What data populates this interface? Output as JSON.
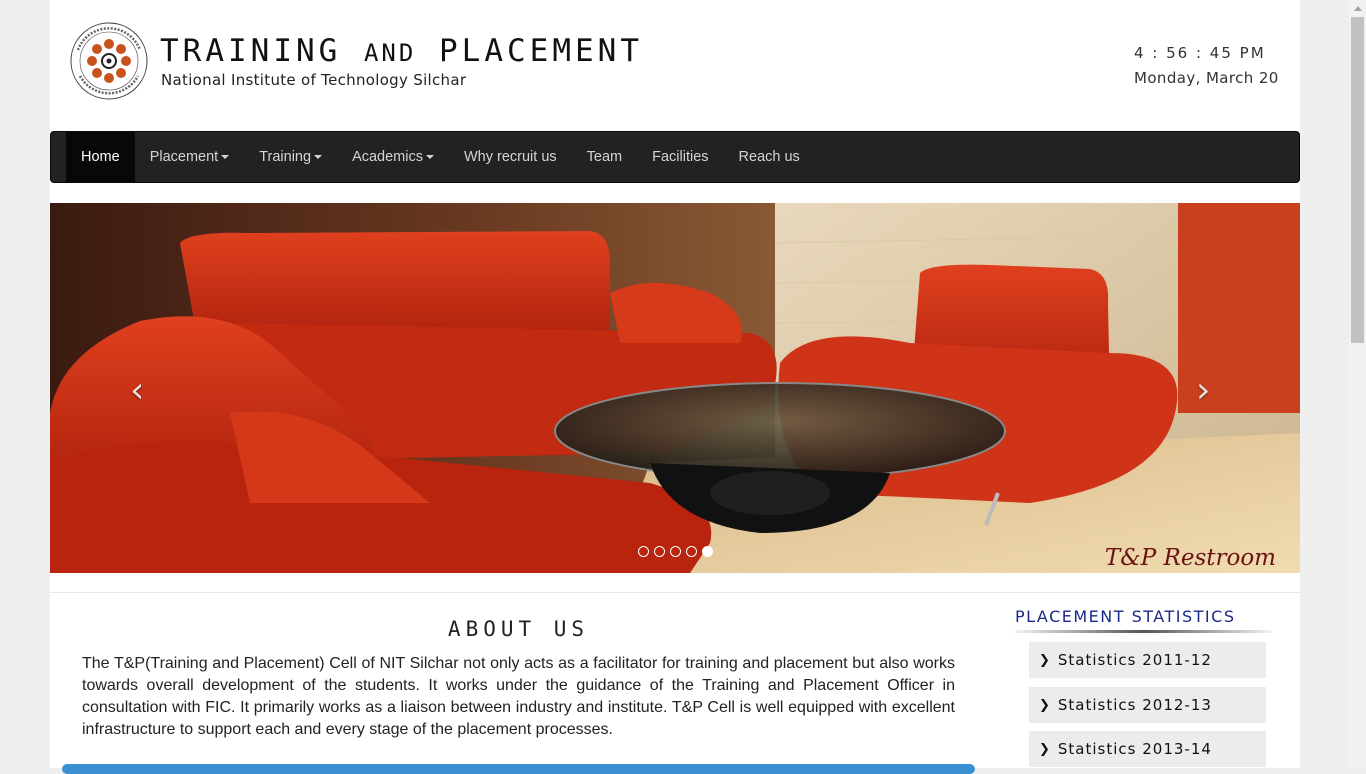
{
  "header": {
    "title_part1": "TRAINING",
    "title_part2": "AND",
    "title_part3": "PLACEMENT",
    "subtitle": "National Institute of Technology Silchar",
    "clock_time": "4 : 56 : 45 PM",
    "clock_date": "Monday, March 20"
  },
  "nav": {
    "items": [
      {
        "label": "Home"
      },
      {
        "label": "Placement"
      },
      {
        "label": "Training"
      },
      {
        "label": "Academics"
      },
      {
        "label": "Why recruit us"
      },
      {
        "label": "Team"
      },
      {
        "label": "Facilities"
      },
      {
        "label": "Reach us"
      }
    ]
  },
  "carousel": {
    "caption": "T&P Restroom",
    "prev_icon": "chevron-left-icon",
    "next_icon": "chevron-right-icon",
    "slide_count": 5,
    "active_slide": 5
  },
  "about": {
    "heading": "ABOUT US",
    "text": "The T&P(Training and Placement) Cell of NIT Silchar not only acts as a facilitator for training and placement but also works towards overall development of the students. It works under the guidance of the Training and Placement Officer in consultation with FIC. It primarily works as a liaison between industry and institute. T&P Cell is well equipped with excellent infrastructure to support each and every stage of the placement processes."
  },
  "stats": {
    "heading": "PLACEMENT STATISTICS",
    "items": [
      {
        "label": "Statistics 2011-12"
      },
      {
        "label": "Statistics 2012-13"
      },
      {
        "label": "Statistics 2013-14"
      }
    ]
  },
  "colors": {
    "navbar_bg": "#222222",
    "nav_active_bg": "#080808",
    "stats_heading": "#1a2a8a",
    "accent_blue": "#3a8fd0",
    "sofa_red": "#c62a14"
  }
}
